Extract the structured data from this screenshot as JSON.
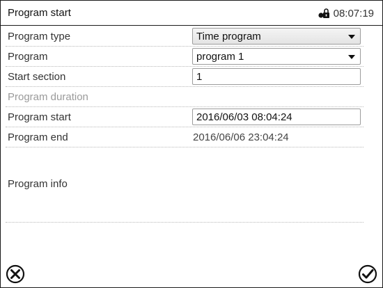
{
  "header": {
    "title": "Program start",
    "time": "08:07:19",
    "lock_icon": "user-lock-icon"
  },
  "form": {
    "program_type": {
      "label": "Program type",
      "value": "Time program"
    },
    "program": {
      "label": "Program",
      "value": "program 1"
    },
    "start_section": {
      "label": "Start section",
      "value": "1"
    },
    "program_duration": {
      "label": "Program duration"
    },
    "program_start": {
      "label": "Program start",
      "value": "2016/06/03 08:04:24"
    },
    "program_end": {
      "label": "Program end",
      "value": "2016/06/06 23:04:24"
    },
    "program_info": {
      "label": "Program info"
    }
  },
  "footer": {
    "cancel_icon": "close-circle-icon",
    "confirm_icon": "check-circle-icon"
  },
  "colors": {
    "border": "#1a1a1a",
    "text": "#333333",
    "disabled_text": "#9a9a9a",
    "separator": "#b8b8b8"
  }
}
